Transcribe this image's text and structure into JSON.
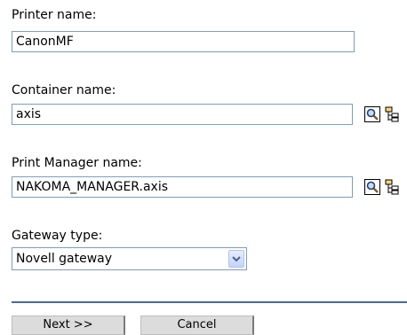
{
  "form": {
    "printer_name": {
      "label": "Printer name:",
      "value": "CanonMF"
    },
    "container_name": {
      "label": "Container name:",
      "value": "axis"
    },
    "print_manager_name": {
      "label": "Print Manager name:",
      "value": "NAKOMA_MANAGER.axis"
    },
    "gateway_type": {
      "label": "Gateway type:",
      "selected": "Novell gateway"
    }
  },
  "buttons": {
    "next": "Next >>",
    "cancel": "Cancel"
  },
  "icons": {
    "search": "search-icon",
    "browse": "browse-tree-icon"
  }
}
